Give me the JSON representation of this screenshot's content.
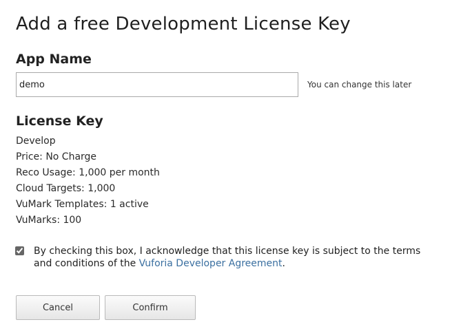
{
  "page": {
    "title": "Add a free Development License Key"
  },
  "app_name": {
    "heading": "App Name",
    "value": "demo",
    "hint": "You can change this later"
  },
  "license_key": {
    "heading": "License Key",
    "details": [
      "Develop",
      "Price: No Charge",
      "Reco Usage: 1,000 per month",
      "Cloud Targets: 1,000",
      "VuMark Templates: 1 active",
      "VuMarks: 100"
    ]
  },
  "agreement": {
    "checked": true,
    "text_before": "By checking this box, I acknowledge that this license key is subject to the terms and conditions of the ",
    "link_text": "Vuforia Developer Agreement",
    "text_after": ".",
    "link_color": "#3a6fa0"
  },
  "buttons": {
    "cancel_label": "Cancel",
    "confirm_label": "Confirm"
  }
}
